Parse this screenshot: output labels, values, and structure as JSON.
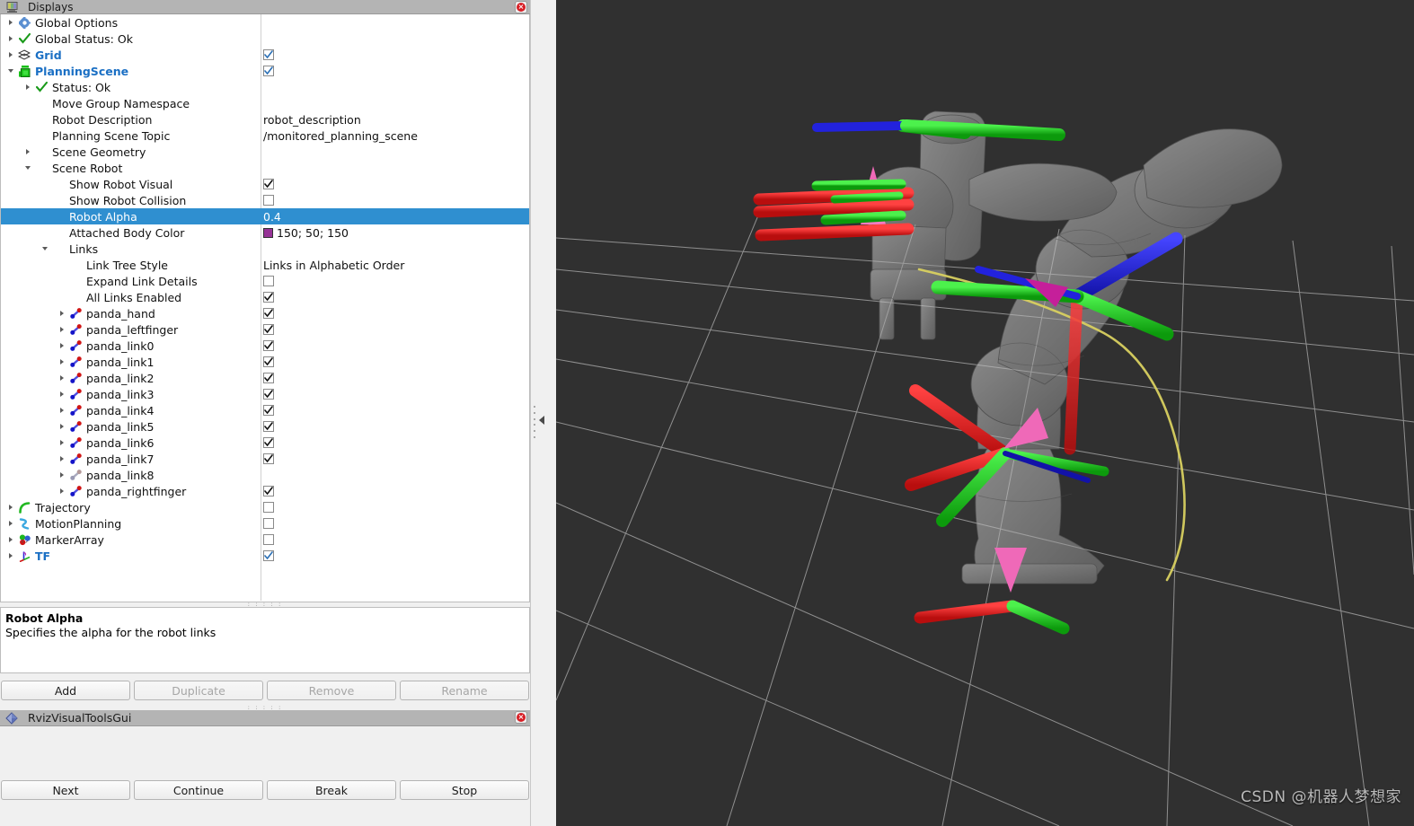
{
  "displays_panel": {
    "title": "Displays",
    "title_icon": "monitor-icon",
    "close_label": "×",
    "tree": [
      {
        "indent": 0,
        "arrow": "closed",
        "icon": "gear-icon",
        "label": "Global Options",
        "style": "plain",
        "value_type": "none"
      },
      {
        "indent": 0,
        "arrow": "closed",
        "icon": "check-icon",
        "label": "Global Status: Ok",
        "style": "plain",
        "value_type": "none"
      },
      {
        "indent": 0,
        "arrow": "closed",
        "icon": "grid-icon",
        "label": "Grid",
        "style": "blue",
        "value_type": "checkbox",
        "checked": true,
        "check_color": "#2a6fb5"
      },
      {
        "indent": 0,
        "arrow": "open",
        "icon": "planningscene-icon",
        "label": "PlanningScene",
        "style": "blue",
        "value_type": "checkbox",
        "checked": true,
        "check_color": "#2a6fb5"
      },
      {
        "indent": 1,
        "arrow": "closed",
        "icon": "check-icon",
        "label": "Status: Ok",
        "style": "plain",
        "value_type": "none"
      },
      {
        "indent": 1,
        "arrow": "hidden",
        "icon": "none",
        "label": "Move Group Namespace",
        "style": "plain",
        "value_type": "none"
      },
      {
        "indent": 1,
        "arrow": "hidden",
        "icon": "none",
        "label": "Robot Description",
        "style": "plain",
        "value_type": "text",
        "value": "robot_description"
      },
      {
        "indent": 1,
        "arrow": "hidden",
        "icon": "none",
        "label": "Planning Scene Topic",
        "style": "plain",
        "value_type": "text",
        "value": "/monitored_planning_scene"
      },
      {
        "indent": 1,
        "arrow": "closed",
        "icon": "none",
        "label": "Scene Geometry",
        "style": "plain",
        "value_type": "none"
      },
      {
        "indent": 1,
        "arrow": "open",
        "icon": "none",
        "label": "Scene Robot",
        "style": "plain",
        "value_type": "none"
      },
      {
        "indent": 2,
        "arrow": "hidden",
        "icon": "none",
        "label": "Show Robot Visual",
        "style": "plain",
        "value_type": "checkbox",
        "checked": true,
        "check_color": "#111111"
      },
      {
        "indent": 2,
        "arrow": "hidden",
        "icon": "none",
        "label": "Show Robot Collision",
        "style": "plain",
        "value_type": "checkbox",
        "checked": false,
        "check_color": "#111111"
      },
      {
        "indent": 2,
        "arrow": "hidden",
        "icon": "none",
        "label": "Robot Alpha",
        "style": "plain",
        "value_type": "text",
        "value": "0.4",
        "selected": true
      },
      {
        "indent": 2,
        "arrow": "hidden",
        "icon": "none",
        "label": "Attached Body Color",
        "style": "plain",
        "value_type": "color",
        "value": "150; 50; 150",
        "swatch": "#963296"
      },
      {
        "indent": 2,
        "arrow": "open",
        "icon": "none",
        "label": "Links",
        "style": "plain",
        "value_type": "none"
      },
      {
        "indent": 3,
        "arrow": "hidden",
        "icon": "none",
        "label": "Link Tree Style",
        "style": "plain",
        "value_type": "text",
        "value": "Links in Alphabetic Order"
      },
      {
        "indent": 3,
        "arrow": "hidden",
        "icon": "none",
        "label": "Expand Link Details",
        "style": "plain",
        "value_type": "checkbox",
        "checked": false,
        "check_color": "#111111"
      },
      {
        "indent": 3,
        "arrow": "hidden",
        "icon": "none",
        "label": "All Links Enabled",
        "style": "plain",
        "value_type": "checkbox",
        "checked": true,
        "check_color": "#111111"
      },
      {
        "indent": 3,
        "arrow": "closed",
        "icon": "link-icon",
        "label": "panda_hand",
        "style": "plain",
        "value_type": "checkbox",
        "checked": true,
        "check_color": "#111111"
      },
      {
        "indent": 3,
        "arrow": "closed",
        "icon": "link-icon",
        "label": "panda_leftfinger",
        "style": "plain",
        "value_type": "checkbox",
        "checked": true,
        "check_color": "#111111"
      },
      {
        "indent": 3,
        "arrow": "closed",
        "icon": "link-icon",
        "label": "panda_link0",
        "style": "plain",
        "value_type": "checkbox",
        "checked": true,
        "check_color": "#111111"
      },
      {
        "indent": 3,
        "arrow": "closed",
        "icon": "link-icon",
        "label": "panda_link1",
        "style": "plain",
        "value_type": "checkbox",
        "checked": true,
        "check_color": "#111111"
      },
      {
        "indent": 3,
        "arrow": "closed",
        "icon": "link-icon",
        "label": "panda_link2",
        "style": "plain",
        "value_type": "checkbox",
        "checked": true,
        "check_color": "#111111"
      },
      {
        "indent": 3,
        "arrow": "closed",
        "icon": "link-icon",
        "label": "panda_link3",
        "style": "plain",
        "value_type": "checkbox",
        "checked": true,
        "check_color": "#111111"
      },
      {
        "indent": 3,
        "arrow": "closed",
        "icon": "link-icon",
        "label": "panda_link4",
        "style": "plain",
        "value_type": "checkbox",
        "checked": true,
        "check_color": "#111111"
      },
      {
        "indent": 3,
        "arrow": "closed",
        "icon": "link-icon",
        "label": "panda_link5",
        "style": "plain",
        "value_type": "checkbox",
        "checked": true,
        "check_color": "#111111"
      },
      {
        "indent": 3,
        "arrow": "closed",
        "icon": "link-icon",
        "label": "panda_link6",
        "style": "plain",
        "value_type": "checkbox",
        "checked": true,
        "check_color": "#111111"
      },
      {
        "indent": 3,
        "arrow": "closed",
        "icon": "link-icon",
        "label": "panda_link7",
        "style": "plain",
        "value_type": "checkbox",
        "checked": true,
        "check_color": "#111111"
      },
      {
        "indent": 3,
        "arrow": "closed",
        "icon": "link-icon-disabled",
        "label": "panda_link8",
        "style": "plain",
        "value_type": "none"
      },
      {
        "indent": 3,
        "arrow": "closed",
        "icon": "link-icon",
        "label": "panda_rightfinger",
        "style": "plain",
        "value_type": "checkbox",
        "checked": true,
        "check_color": "#111111"
      },
      {
        "indent": 0,
        "arrow": "closed",
        "icon": "trajectory-icon",
        "label": "Trajectory",
        "style": "plain",
        "value_type": "checkbox",
        "checked": false,
        "check_color": "#111111"
      },
      {
        "indent": 0,
        "arrow": "closed",
        "icon": "motionplanning-icon",
        "label": "MotionPlanning",
        "style": "plain",
        "value_type": "checkbox",
        "checked": false,
        "check_color": "#111111"
      },
      {
        "indent": 0,
        "arrow": "closed",
        "icon": "markerarray-icon",
        "label": "MarkerArray",
        "style": "plain",
        "value_type": "checkbox",
        "checked": false,
        "check_color": "#111111"
      },
      {
        "indent": 0,
        "arrow": "closed",
        "icon": "tf-icon",
        "label": "TF",
        "style": "blue",
        "value_type": "checkbox",
        "checked": true,
        "check_color": "#2a6fb5"
      }
    ],
    "description": {
      "title": "Robot Alpha",
      "text": "Specifies the alpha for the robot links"
    },
    "buttons": [
      {
        "label": "Add",
        "enabled": true
      },
      {
        "label": "Duplicate",
        "enabled": false
      },
      {
        "label": "Remove",
        "enabled": false
      },
      {
        "label": "Rename",
        "enabled": false
      }
    ]
  },
  "rviz_visual_tools_panel": {
    "title": "RvizVisualToolsGui",
    "title_icon": "diamond-icon",
    "close_label": "×",
    "buttons": [
      {
        "label": "Next"
      },
      {
        "label": "Continue"
      },
      {
        "label": "Break"
      },
      {
        "label": "Stop"
      }
    ]
  },
  "viewport": {
    "background_color": "#303030",
    "grid_color": "#b4b4b4",
    "watermark": "CSDN @机器人梦想家",
    "robot_color": "#b9b9b9",
    "axis_colors": {
      "x": "#e01b1b",
      "y": "#1fc41f",
      "z": "#2222dd"
    },
    "marker_colors": {
      "pink": "#ef69b8",
      "yellow": "#d8d060",
      "magenta": "#c51f9a"
    }
  },
  "splitter": {
    "collapse_icon": "collapse-left-arrow-icon"
  }
}
